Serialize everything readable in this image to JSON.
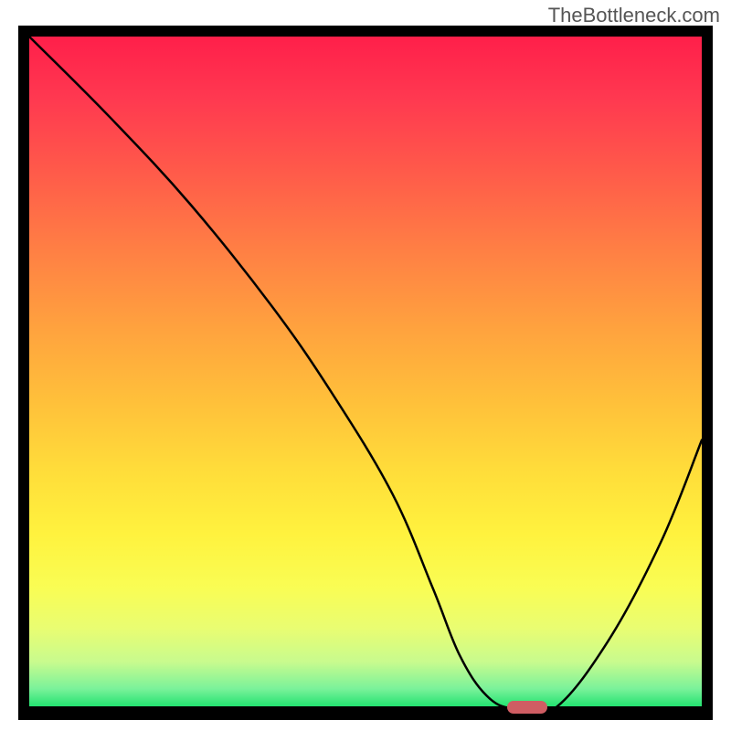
{
  "watermark": "TheBottleneck.com",
  "chart_data": {
    "type": "line",
    "title": "",
    "xlabel": "",
    "ylabel": "",
    "xlim": [
      0,
      100
    ],
    "ylim": [
      0,
      100
    ],
    "x": [
      0,
      12,
      24,
      36,
      45,
      54,
      60,
      64,
      68,
      72,
      78,
      86,
      94,
      100
    ],
    "values": [
      100,
      88,
      75,
      60,
      47,
      32,
      18,
      8,
      2,
      0,
      0,
      10,
      25,
      40
    ],
    "marker_x": 74,
    "marker_color": "#cf5d63",
    "gradient_stops": [
      {
        "pos": 0,
        "color": "#ff1f4a"
      },
      {
        "pos": 9,
        "color": "#ff3850"
      },
      {
        "pos": 20,
        "color": "#ff5a4a"
      },
      {
        "pos": 32,
        "color": "#ff8044"
      },
      {
        "pos": 44,
        "color": "#ffa43e"
      },
      {
        "pos": 55,
        "color": "#ffc23a"
      },
      {
        "pos": 65,
        "color": "#ffde3a"
      },
      {
        "pos": 74,
        "color": "#fff23e"
      },
      {
        "pos": 82,
        "color": "#f9fd54"
      },
      {
        "pos": 88,
        "color": "#e9fd72"
      },
      {
        "pos": 93,
        "color": "#c8fb8e"
      },
      {
        "pos": 97,
        "color": "#7af29a"
      },
      {
        "pos": 100,
        "color": "#16e06a"
      }
    ]
  }
}
